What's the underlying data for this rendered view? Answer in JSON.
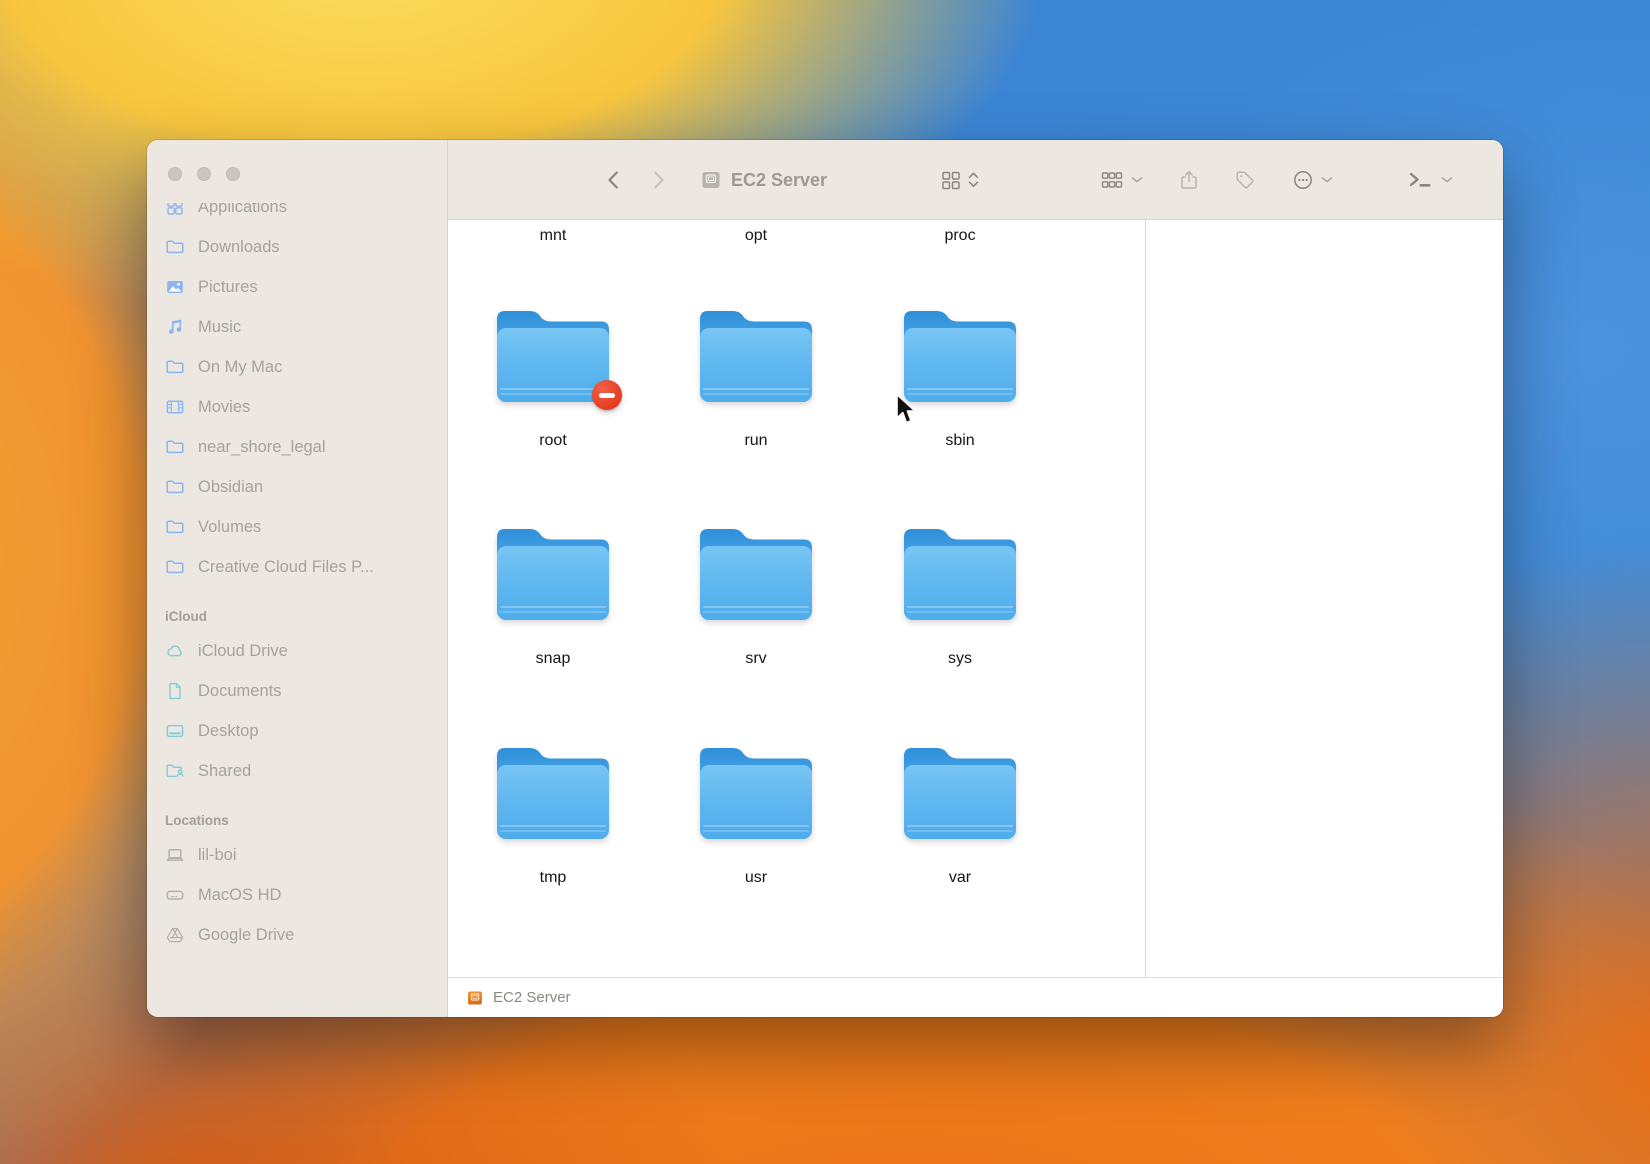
{
  "toolbar": {
    "title": "EC2 Server"
  },
  "sidebar": {
    "favorites": [
      {
        "label": "Applications"
      },
      {
        "label": "Downloads"
      },
      {
        "label": "Pictures"
      },
      {
        "label": "Music"
      },
      {
        "label": "On My Mac"
      },
      {
        "label": "Movies"
      },
      {
        "label": "near_shore_legal"
      },
      {
        "label": "Obsidian"
      },
      {
        "label": "Volumes"
      },
      {
        "label": "Creative Cloud Files P..."
      }
    ],
    "icloud_header": "iCloud",
    "icloud": [
      {
        "label": "iCloud Drive"
      },
      {
        "label": "Documents"
      },
      {
        "label": "Desktop"
      },
      {
        "label": "Shared"
      }
    ],
    "locations_header": "Locations",
    "locations": [
      {
        "label": "lil-boi"
      },
      {
        "label": "MacOS HD"
      },
      {
        "label": "Google Drive"
      }
    ]
  },
  "content": {
    "top_labels": [
      "mnt",
      "opt",
      "proc"
    ],
    "folders": [
      {
        "name": "root",
        "badge": "no-access"
      },
      {
        "name": "run"
      },
      {
        "name": "sbin"
      },
      {
        "name": "snap"
      },
      {
        "name": "srv"
      },
      {
        "name": "sys"
      },
      {
        "name": "tmp"
      },
      {
        "name": "usr"
      },
      {
        "name": "var"
      }
    ]
  },
  "statusbar": {
    "item_label": "EC2 Server"
  },
  "colors": {
    "folder_blue": "#5db6ef",
    "folder_tab_blue": "#2f8fd9",
    "badge_red": "#e63b1f",
    "chrome_beige": "#ece8e1",
    "sidebar_text": "#a6a19b",
    "status_icon_orange": "#e87722"
  }
}
